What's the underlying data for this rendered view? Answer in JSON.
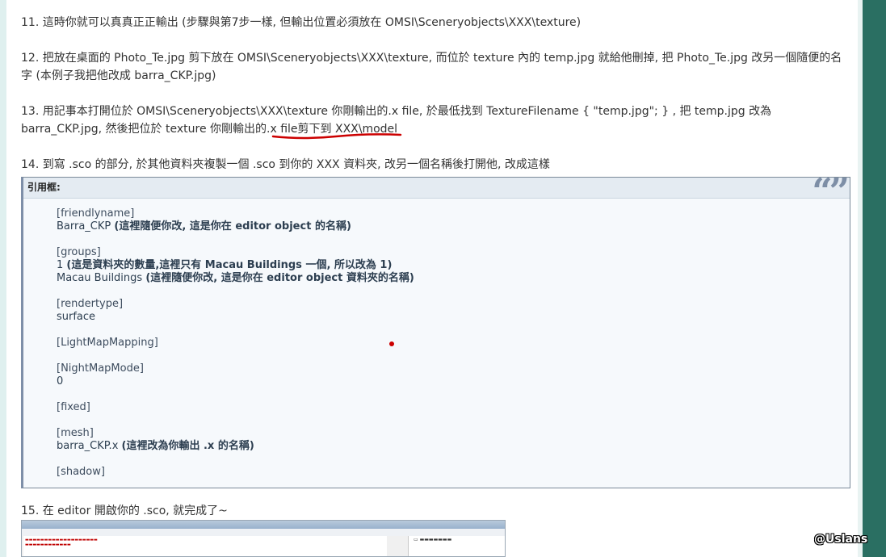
{
  "steps": {
    "s11": "11. 這時你就可以真真正正輸出 (步驟與第7步一樣, 但輸出位置必須放在 OMSI\\Sceneryobjects\\XXX\\texture)",
    "s12": "12. 把放在桌面的 Photo_Te.jpg 剪下放在 OMSI\\Sceneryobjects\\XXX\\texture, 而位於 texture 內的 temp.jpg 就給他刪掉, 把 Photo_Te.jpg  改另一個隨便的名字 (本例子我把他改成 barra_CKP.jpg)",
    "s13_part1": "13. 用記事本打開位於 OMSI\\Sceneryobjects\\XXX\\texture 你剛輸出的.x file, 於最低找到 TextureFilename { \"temp.jpg\"; } , 把 temp.jpg 改為 barra_CKP.jpg, 然後把位於 texture 你剛輸出的",
    "s13_part2": ".x file剪下到 XXX\\model",
    "s14": "14. 到寫 .sco 的部分, 於其他資料夾複製一個 .sco 到你的 XXX 資料夾, 改另一個名稱後打開他, 改成這樣",
    "s15": "15. 在 editor 開啟你的 .sco, 就完成了~"
  },
  "quote": {
    "label": "引用框:",
    "mark": "“”",
    "lines": {
      "l1": "[friendlyname]",
      "l2a": "Barra_CKP ",
      "l2b": "(這裡隨便你改, 這是你在 editor object 的名稱)",
      "l3": "[groups]",
      "l4a": "1 ",
      "l4b": "(這是資料夾的數量,這裡只有 Macau Buildings 一個, 所以改為 1)",
      "l5a": "Macau Buildings ",
      "l5b": "(這裡隨便你改, 這是你在 editor object 資料夾的名稱)",
      "l6": "[rendertype]",
      "l7": "surface",
      "l8": "[LightMapMapping]",
      "l9": "[NightMapMode]",
      "l10": "0",
      "l11": "[fixed]",
      "l12": "[mesh]",
      "l13a": "barra_CKP.x ",
      "l13b": "(這裡改為你輸出 .x 的名稱)",
      "l14": "[shadow]"
    }
  },
  "watermark": "@Uslans",
  "colors": {
    "right_panel": "#2a6f62",
    "annotation_red": "#cc0000",
    "quote_accent": "#7e8fa8"
  }
}
